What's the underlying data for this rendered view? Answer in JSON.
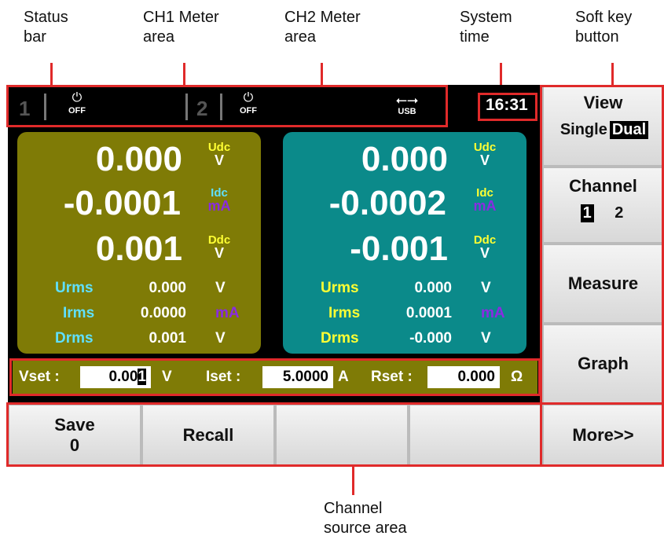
{
  "annotations": {
    "status_bar": "Status\nbar",
    "ch1_meter_area": "CH1 Meter\narea",
    "ch2_meter_area": "CH2 Meter\narea",
    "system_time": "System\ntime",
    "soft_key_button": "Soft key\nbutton",
    "channel_source_area": "Channel\nsource area"
  },
  "status_bar": {
    "ch1_number": "1",
    "ch1_power": "OFF",
    "ch2_number": "2",
    "ch2_power": "OFF",
    "usb_label": "USB",
    "time": "16:31"
  },
  "ch1": {
    "voltage": "0.000",
    "voltage_label": "Udc",
    "voltage_unit": "V",
    "current": "-0.0001",
    "current_label": "Idc",
    "current_unit": "mA",
    "power": "0.001",
    "power_label": "Ddc",
    "power_unit": "V",
    "rms": [
      {
        "label": "Urms",
        "value": "0.000",
        "unit": "V"
      },
      {
        "label": "Irms",
        "value": "0.0000",
        "unit": "mA"
      },
      {
        "label": "Drms",
        "value": "0.001",
        "unit": "V"
      }
    ]
  },
  "ch2": {
    "voltage": "0.000",
    "voltage_label": "Udc",
    "voltage_unit": "V",
    "current": "-0.0002",
    "current_label": "Idc",
    "current_unit": "mA",
    "power": "-0.001",
    "power_label": "Ddc",
    "power_unit": "V",
    "rms": [
      {
        "label": "Urms",
        "value": "0.000",
        "unit": "V"
      },
      {
        "label": "Irms",
        "value": "0.0001",
        "unit": "mA"
      },
      {
        "label": "Drms",
        "value": "-0.000",
        "unit": "V"
      }
    ]
  },
  "source": {
    "vset_label": "Vset :",
    "vset_value_main": "0.00",
    "vset_value_cursor": "1",
    "vset_unit": "V",
    "iset_label": "Iset :",
    "iset_value": "5.0000",
    "iset_unit": "A",
    "rset_label": "Rset :",
    "rset_value": "0.000",
    "rset_unit": "Ω"
  },
  "bottom_keys": {
    "save_label": "Save",
    "save_value": "0",
    "recall_label": "Recall",
    "blank1": "",
    "blank2": ""
  },
  "soft_keys": {
    "view_label": "View",
    "view_single": "Single",
    "view_dual": "Dual",
    "channel_label": "Channel",
    "channel_1": "1",
    "channel_2": "2",
    "measure_label": "Measure",
    "graph_label": "Graph",
    "more_label": "More>>"
  },
  "colors": {
    "ch1_bg": "#7f7b06",
    "ch2_bg": "#0b8a8a",
    "label_yellow": "#ffff33",
    "label_cyan": "#5fe0ff",
    "mA_purple": "#8a2be2",
    "annotation_red": "#e02a2a"
  }
}
